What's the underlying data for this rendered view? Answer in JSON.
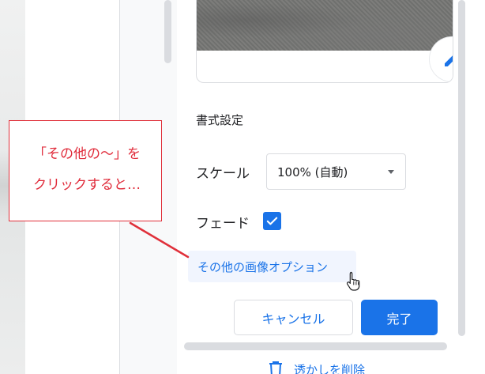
{
  "panel": {
    "section_heading": "書式設定",
    "scale_label": "スケール",
    "scale_value": "100% (自動)",
    "fade_label": "フェード",
    "fade_checked": true,
    "more_options": "その他の画像オプション",
    "cancel_label": "キャンセル",
    "done_label": "完了",
    "remove_watermark": "透かしを削除"
  },
  "callout": {
    "line1": "「その他の〜」を",
    "line2": "クリックすると…"
  },
  "colors": {
    "accent": "#1a73e8",
    "annotation": "#e0303a"
  },
  "icons": [
    "pencil-icon",
    "caret-down-icon",
    "checkmark-icon",
    "hand-pointer-icon",
    "trash-icon"
  ]
}
